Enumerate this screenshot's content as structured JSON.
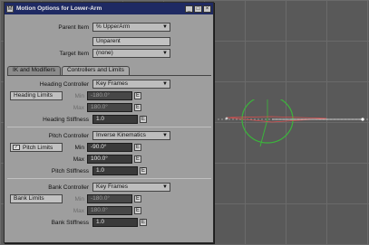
{
  "window": {
    "title": "Motion Options for Lower-Arm",
    "icon_label": "M",
    "minimize_label": "_",
    "maximize_label": "□",
    "close_label": "×"
  },
  "parent": {
    "label": "Parent Item",
    "value": "% UpperArm",
    "unparent_label": "Unparent"
  },
  "target": {
    "label": "Target Item",
    "value": "(none)"
  },
  "tabs": [
    {
      "label": "IK and Modifiers"
    },
    {
      "label": "Controllers and Limits"
    }
  ],
  "heading": {
    "controller_label": "Heading Controller",
    "controller_value": "Key Frames",
    "limits_label": "Heading Limits",
    "min_label": "Min",
    "min_value": "-180.0°",
    "max_label": "Max",
    "max_value": "180.0°",
    "stiffness_label": "Heading Stiffness",
    "stiffness_value": "1.0"
  },
  "pitch": {
    "controller_label": "Pitch Controller",
    "controller_value": "Inverse Kinematics",
    "limits_label": "Pitch Limits",
    "limits_checked_glyph": "✓",
    "min_label": "Min",
    "min_value": "-90.0°",
    "max_label": "Max",
    "max_value": "100.0°",
    "stiffness_label": "Pitch Stiffness",
    "stiffness_value": "1.0"
  },
  "bank": {
    "controller_label": "Bank Controller",
    "controller_value": "Key Frames",
    "limits_label": "Bank Limits",
    "min_label": "Min",
    "min_value": "-180.0°",
    "max_label": "Max",
    "max_value": "180.0°",
    "stiffness_label": "Bank Stiffness",
    "stiffness_value": "1.0"
  },
  "icons": {
    "dropdown": "chevron-down-icon",
    "envelope": "envelope-icon"
  },
  "colors": {
    "title_bar": "#1f2a63",
    "viewport_bg": "#595959",
    "field_bg": "#3a3a3a",
    "rig_circle": "#3bb53b",
    "rig_bone": "#d85050"
  }
}
